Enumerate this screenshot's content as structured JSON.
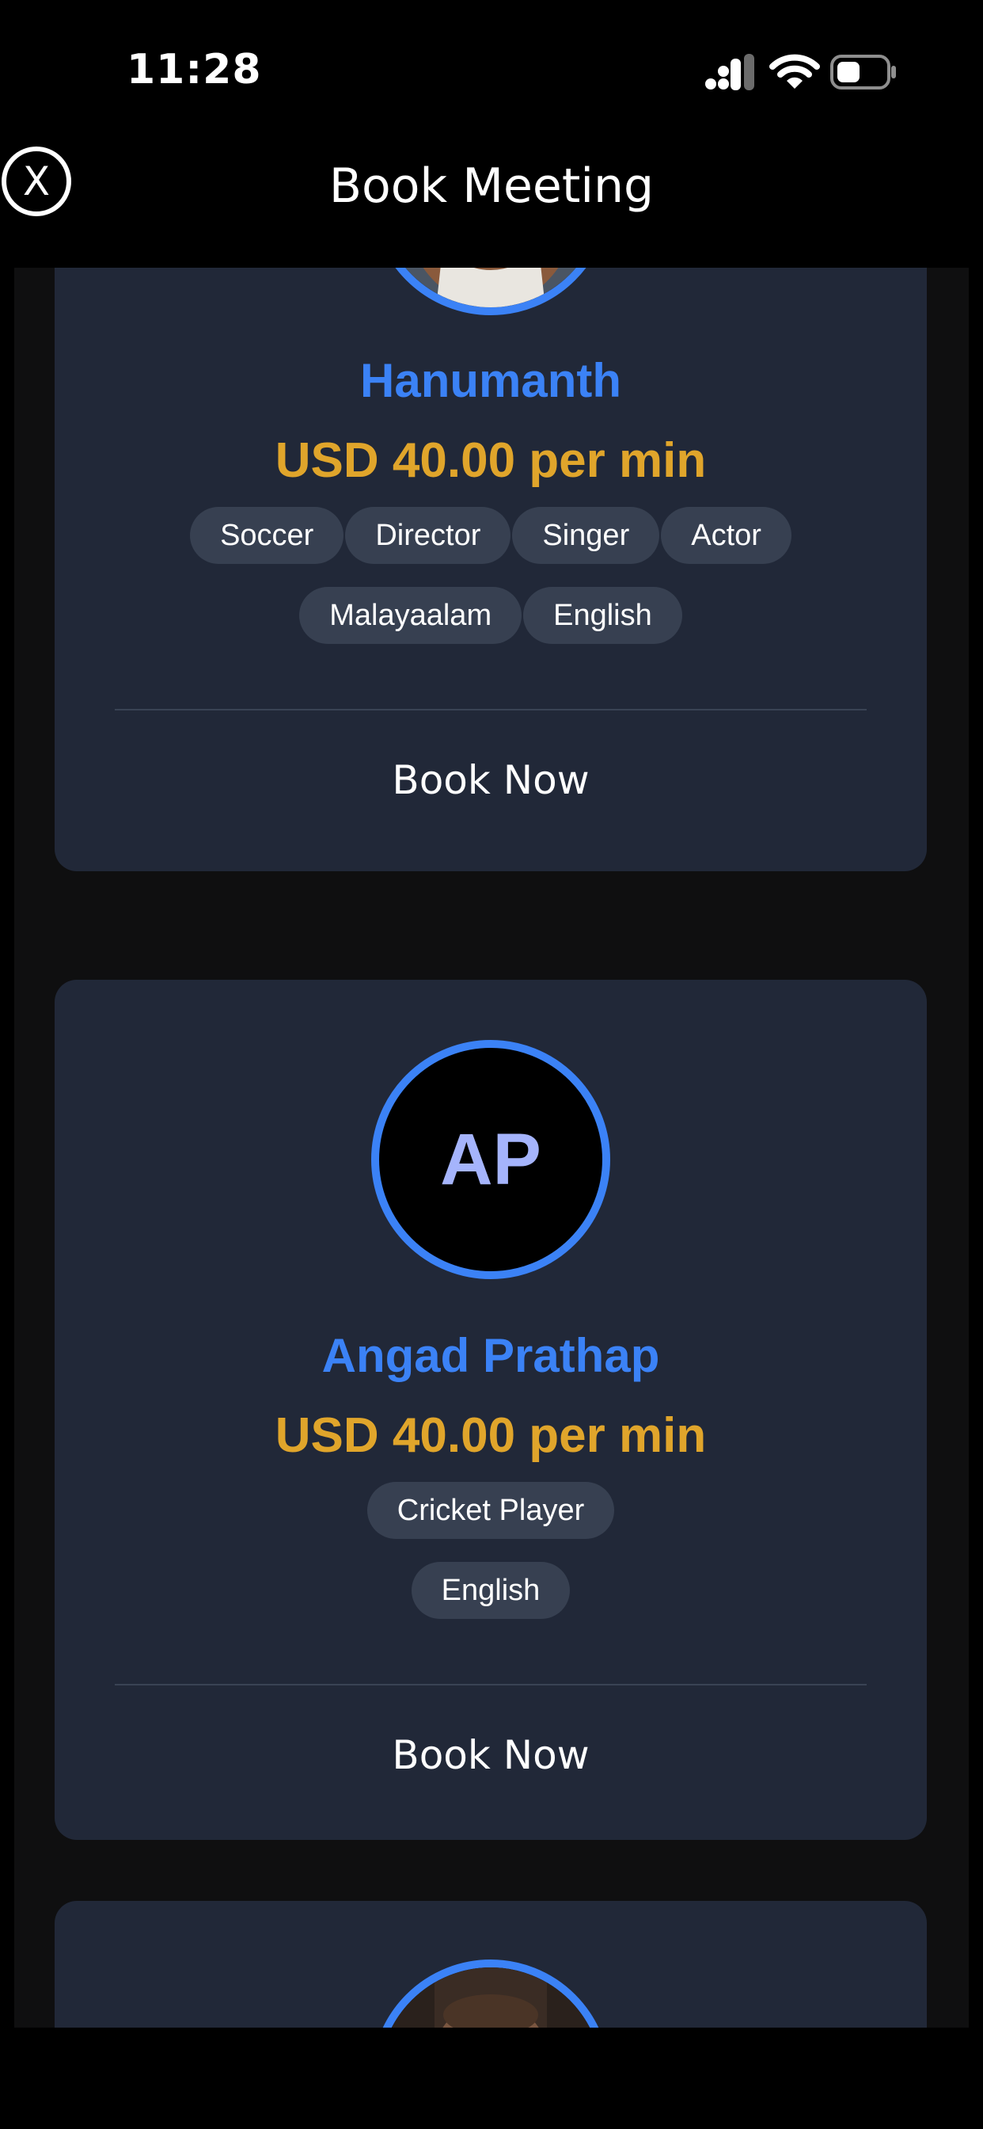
{
  "status_bar": {
    "time": "11:28",
    "icons": [
      "cellular-signal-icon",
      "wifi-icon",
      "battery-icon"
    ]
  },
  "header": {
    "close_label": "X",
    "title": "Book Meeting"
  },
  "colors": {
    "background": "#000000",
    "card": "#212838",
    "chip": "#374051",
    "name": "#3b82f6",
    "price": "#e0a52b",
    "avatar_ring": "#3b82f6",
    "initials": "#a5b4fc"
  },
  "hosts": [
    {
      "name": "Hanumanth",
      "price": "USD 40.00 per min",
      "avatar": "photo",
      "tags": [
        "Soccer",
        "Director",
        "Singer",
        "Actor"
      ],
      "languages": [
        "Malayaalam",
        "English"
      ],
      "book_label": "Book Now"
    },
    {
      "name": "Angad Prathap",
      "price": "USD 40.00 per min",
      "avatar": "initials",
      "initials": "AP",
      "tags": [
        "Cricket Player"
      ],
      "languages": [
        "English"
      ],
      "book_label": "Book Now"
    },
    {
      "avatar": "photo"
    }
  ]
}
